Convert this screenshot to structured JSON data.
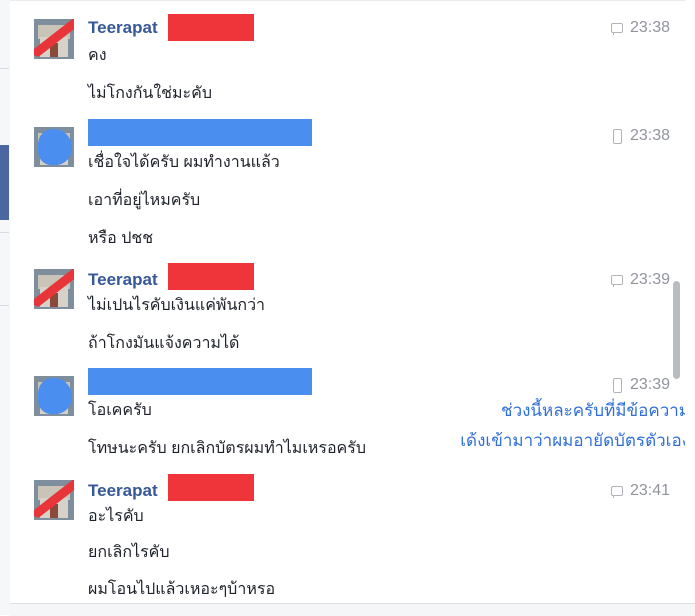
{
  "messages": [
    {
      "sender_name": "Teerapat",
      "sender_redaction": "red",
      "time": "23:38",
      "time_icon": "chat-icon",
      "lines": [
        "คง",
        "ไม่โกงกันใช่มะคับ"
      ]
    },
    {
      "sender_name": "",
      "sender_redaction": "blue",
      "time": "23:38",
      "time_icon": "phone-icon",
      "lines": [
        "เชื่อใจได้ครับ ผมทำงานแล้ว",
        "เอาที่อยู่ไหมครับ",
        "หรือ ปชช"
      ]
    },
    {
      "sender_name": "Teerapat",
      "sender_redaction": "red",
      "time": "23:39",
      "time_icon": "chat-icon",
      "lines": [
        "ไม่เปนไรคับเงินแค่พันกว่า",
        "ถ้าโกงมันแจ้งความได้"
      ]
    },
    {
      "sender_name": "",
      "sender_redaction": "blue",
      "time": "23:39",
      "time_icon": "phone-icon",
      "lines": [
        "โอเคครับ",
        "โทษนะครับ ยกเลิกบัตรผมทำไมเหรอครับ"
      ]
    },
    {
      "sender_name": "Teerapat",
      "sender_redaction": "red",
      "time": "23:41",
      "time_icon": "chat-icon",
      "lines": [
        "อะไรคับ",
        "ยกเลิกไรคับ",
        "ผมโอนไปแล้วเหอะๆบ้าหรอ"
      ]
    }
  ],
  "annotation": {
    "line1": "ช่วงนี้หละครับที่มีข้อความ",
    "line2": "เด้งเข้ามาว่าผมอายัดบัตรตัวเอง"
  },
  "colors": {
    "name": "#365899",
    "redaction_red": "#f0353a",
    "redaction_blue": "#4a8ef0",
    "annotation": "#2f6fd8",
    "time": "#90949c"
  }
}
